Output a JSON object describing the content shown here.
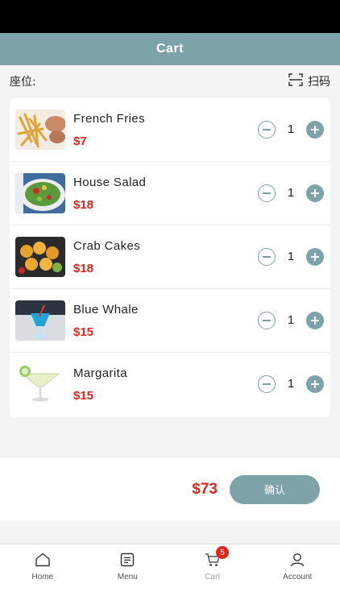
{
  "header": {
    "title": "Cart"
  },
  "seat": {
    "label": "座位:"
  },
  "scan": {
    "label": "扫码",
    "icon": "scan-icon"
  },
  "items": [
    {
      "name": "French Fries",
      "price": "$7",
      "qty": "1",
      "image": "french-fries-photo"
    },
    {
      "name": "House Salad",
      "price": "$18",
      "qty": "1",
      "image": "house-salad-photo"
    },
    {
      "name": "Crab Cakes",
      "price": "$18",
      "qty": "1",
      "image": "crab-cakes-photo"
    },
    {
      "name": "Blue Whale",
      "price": "$15",
      "qty": "1",
      "image": "blue-whale-cocktail-photo"
    },
    {
      "name": "Margarita",
      "price": "$15",
      "qty": "1",
      "image": "margarita-photo"
    }
  ],
  "checkout": {
    "total": "$73",
    "confirm_label": "确认"
  },
  "tabbar": {
    "tabs": [
      {
        "label": "Home",
        "icon": "home-icon"
      },
      {
        "label": "Menu",
        "icon": "menu-icon"
      },
      {
        "label": "Cart",
        "icon": "cart-icon",
        "badge": "5",
        "active": true
      },
      {
        "label": "Account",
        "icon": "account-icon"
      }
    ]
  },
  "colors": {
    "accent": "#7da3a8",
    "price": "#e1251b",
    "badge": "#e1251b"
  }
}
